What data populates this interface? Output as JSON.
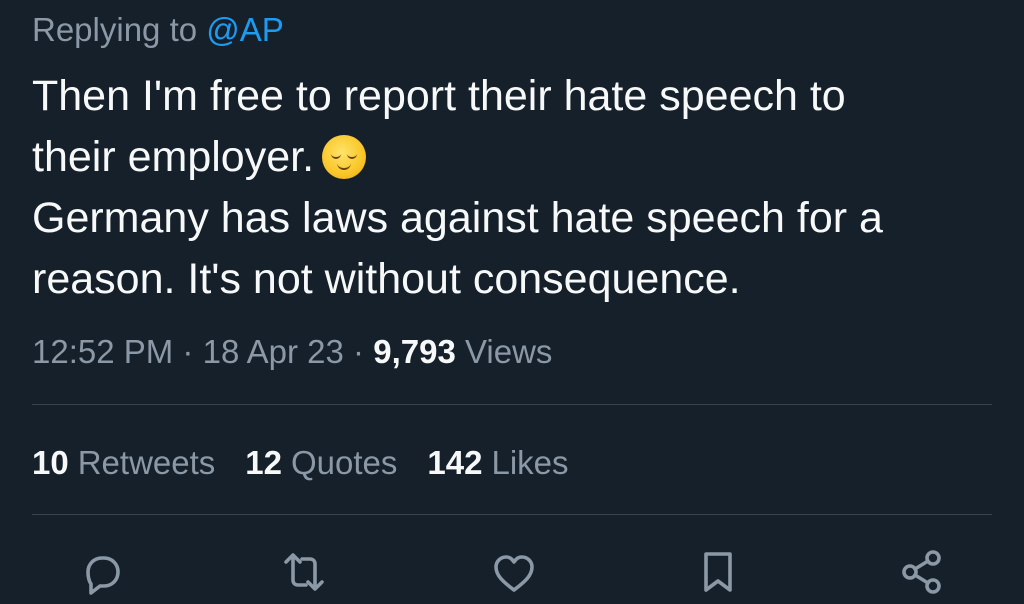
{
  "reply": {
    "prefix": "Replying to",
    "handle": "@AP"
  },
  "tweet": {
    "lines": [
      "Then I'm free to report their hate speech to",
      "their employer.",
      "Germany has laws against hate speech for a",
      "reason. It's not without consequence."
    ],
    "emoji": "relieved-face-emoji"
  },
  "meta": {
    "time": "12:52 PM",
    "separator": "·",
    "date": "18 Apr 23",
    "views_count": "9,793",
    "views_label": "Views"
  },
  "stats": [
    {
      "count": "10",
      "label": "Retweets"
    },
    {
      "count": "12",
      "label": "Quotes"
    },
    {
      "count": "142",
      "label": "Likes"
    }
  ],
  "actions": [
    {
      "icon": "reply-icon"
    },
    {
      "icon": "retweet-icon"
    },
    {
      "icon": "like-icon"
    },
    {
      "icon": "bookmark-icon"
    },
    {
      "icon": "share-icon"
    }
  ],
  "colors": {
    "background": "#15202b",
    "text": "#f7f9f9",
    "secondary_text": "#8b98a5",
    "link": "#1d9bf0",
    "divider": "#38444d"
  }
}
